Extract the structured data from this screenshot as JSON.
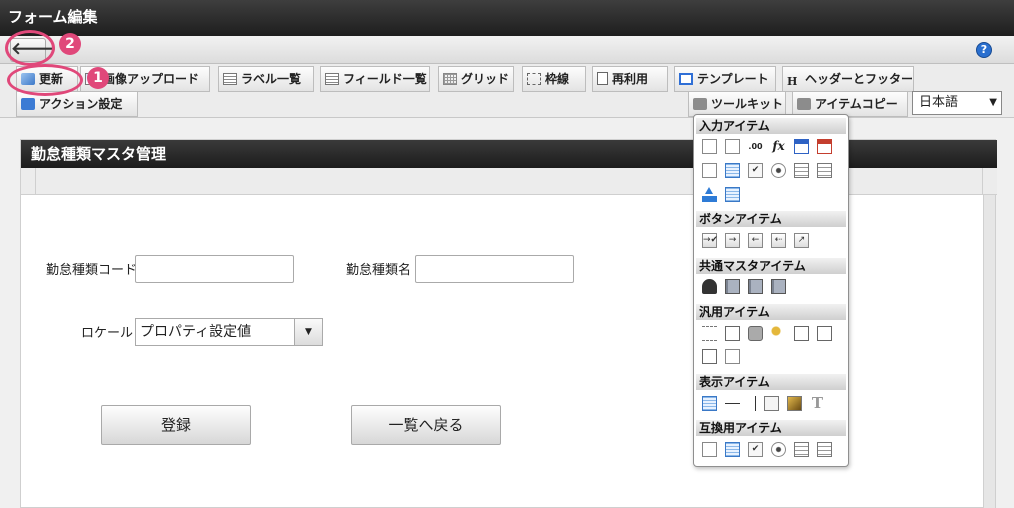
{
  "window": {
    "title": "フォーム編集"
  },
  "nav": {
    "back_icon": "arrow-left-icon",
    "help_icon": "help-icon",
    "help_glyph": "?",
    "back_glyph": "🡐"
  },
  "toolbar": {
    "row1": [
      {
        "label": "更新",
        "icon": "update-icon"
      },
      {
        "label": "画像アップロード",
        "icon": "image-upload-icon"
      },
      {
        "label": "ラベル一覧",
        "icon": "list-icon"
      },
      {
        "label": "フィールド一覧",
        "icon": "list-icon"
      },
      {
        "label": "グリッド",
        "icon": "grid-icon"
      },
      {
        "label": "枠線",
        "icon": "frame-icon"
      },
      {
        "label": "再利用",
        "icon": "document-icon"
      },
      {
        "label": "テンプレート",
        "icon": "template-icon"
      },
      {
        "label": "ヘッダーとフッター",
        "icon": "header-icon",
        "glyph": "H"
      }
    ],
    "row2": [
      {
        "label": "アクション設定",
        "icon": "action-icon"
      },
      {
        "label": "ツールキット",
        "icon": "toolbox-icon"
      },
      {
        "label": "アイテムコピー",
        "icon": "toolbox-icon"
      }
    ],
    "language": {
      "value": "日本語",
      "arrow": "▼"
    }
  },
  "form": {
    "title": "勤怠種類マスタ管理",
    "fields": {
      "code_label": "勤怠種類コード",
      "name_label": "勤怠種類名",
      "locale_label": "ロケール",
      "locale_value": "プロパティ設定値",
      "select_arrow": "▼"
    },
    "buttons": {
      "register": "登録",
      "back_to_list": "一覧へ戻る"
    }
  },
  "annotations": {
    "one": "1",
    "two": "2",
    "accent": "#e0487a"
  },
  "toolkit": {
    "sections": [
      {
        "title": "入力アイテム"
      },
      {
        "title": "ボタンアイテム"
      },
      {
        "title": "共通マスタアイテム"
      },
      {
        "title": "汎用アイテム"
      },
      {
        "title": "表示アイテム"
      },
      {
        "title": "互換用アイテム"
      }
    ],
    "glyphs": {
      "fx": "fx",
      "num": ".00",
      "check": "✔",
      "text_t": "T",
      "btn_check": "→✔",
      "btn_next": "→",
      "btn_prev": "←",
      "btn_back": "⇠",
      "btn_jump": "↗"
    }
  }
}
